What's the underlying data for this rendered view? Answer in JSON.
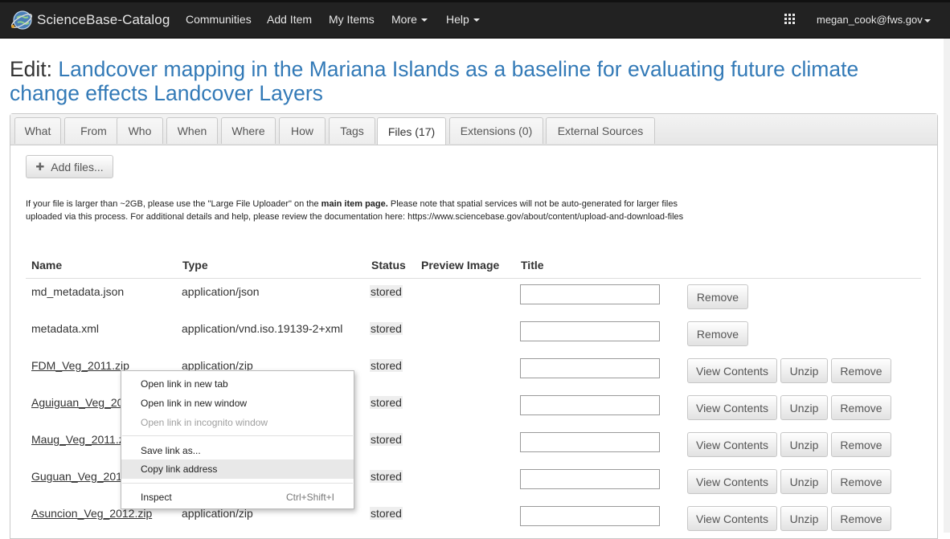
{
  "navbar": {
    "brand": "ScienceBase-Catalog",
    "links": {
      "communities": "Communities",
      "add_item": "Add Item",
      "my_items": "My Items",
      "more": "More",
      "help": "Help"
    },
    "user": "megan_cook@fws.gov",
    "icons": {
      "logo": "globe-icon",
      "apps": "grid-icon",
      "caret": "caret-down-icon"
    }
  },
  "page": {
    "edit_label": "Edit:",
    "item_title": "Landcover mapping in the Mariana Islands as a baseline for evaluating future climate change effects Landcover Layers"
  },
  "tabs": [
    "What",
    "From",
    "Who",
    "When",
    "Where",
    "How",
    "Tags",
    "Files (17)",
    "Extensions (0)",
    "External Sources"
  ],
  "active_tab": "Files (17)",
  "files": {
    "add_button": "Add files...",
    "notice_part1": "If your file is larger than ~2GB, please use the \"Large File Uploader\" on the ",
    "notice_bold": "main item page.",
    "notice_part2": " Please note that spatial services will not be auto-generated for larger files uploaded via this process. For additional details and help, please review the documentation here: https://www.sciencebase.gov/about/content/upload-and-download-files",
    "columns": {
      "name": "Name",
      "type": "Type",
      "status": "Status",
      "preview": "Preview Image",
      "title": "Title"
    },
    "rows": [
      {
        "name": "md_metadata.json",
        "type": "application/json",
        "status": "stored",
        "title": ""
      },
      {
        "name": "metadata.xml",
        "type": "application/vnd.iso.19139-2+xml",
        "status": "stored",
        "title": ""
      },
      {
        "name": "FDM_Veg_2011.zip",
        "type": "application/zip",
        "status": "stored",
        "title": ""
      },
      {
        "name": "Aguiguan_Veg_20",
        "type": "",
        "status": "stored",
        "title": ""
      },
      {
        "name": "Maug_Veg_2011.z",
        "type": "",
        "status": "stored",
        "title": ""
      },
      {
        "name": "Guguan_Veg_201",
        "type": "",
        "status": "stored",
        "title": ""
      },
      {
        "name": "Asuncion_Veg_2012.zip",
        "type": "application/zip",
        "status": "stored",
        "title": ""
      }
    ],
    "buttons": {
      "view_contents": "View Contents",
      "unzip": "Unzip",
      "remove": "Remove"
    }
  },
  "context_menu": {
    "items": [
      {
        "label": "Open link in new tab",
        "disabled": false
      },
      {
        "label": "Open link in new window",
        "disabled": false
      },
      {
        "label": "Open link in incognito window",
        "disabled": true
      },
      {
        "label": "Save link as...",
        "disabled": false
      },
      {
        "label": "Copy link address",
        "disabled": false,
        "highlighted": true
      },
      {
        "label": "Inspect",
        "shortcut": "Ctrl+Shift+I",
        "disabled": false
      }
    ]
  },
  "colors": {
    "navbar_bg": "#222222",
    "link_blue": "#337ab7",
    "status_bg": "#eeeeee"
  }
}
